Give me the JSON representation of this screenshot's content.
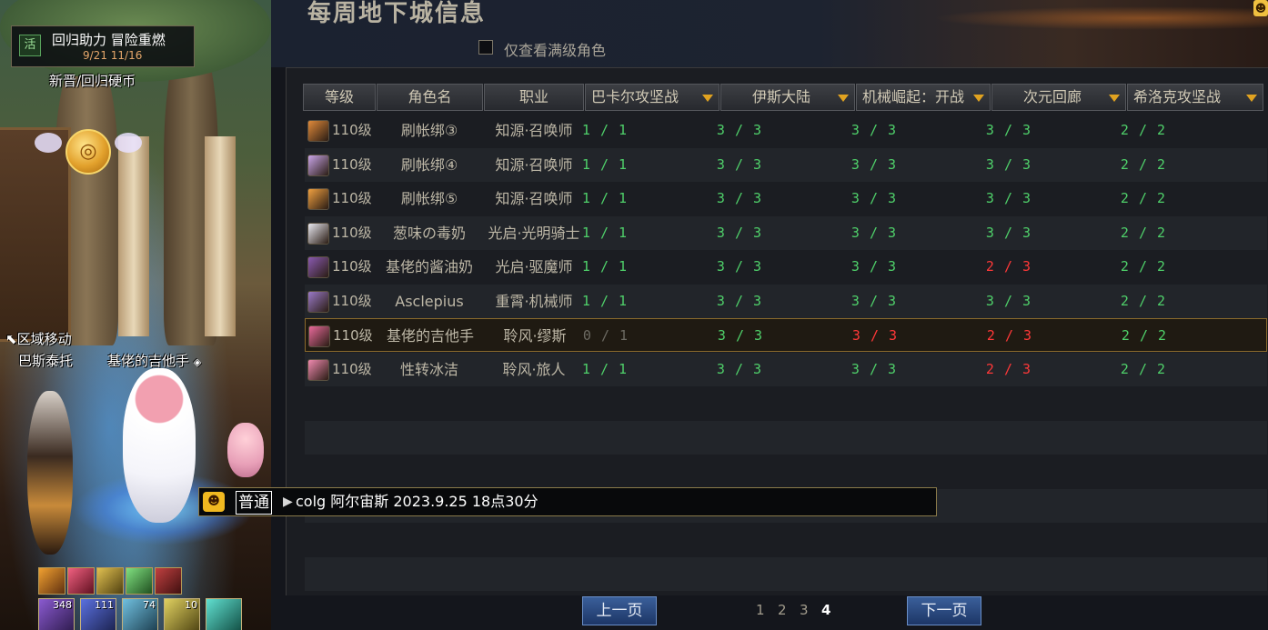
{
  "scene": {
    "event": {
      "badge": "活",
      "title": "回归助力 冒险重燃",
      "date": "9/21 11/16"
    },
    "coin_label": "新晋/回归硬币",
    "coin_icon": "gold-coin-icon",
    "zone_move": "区域移动",
    "zone_name": "巴斯泰托",
    "player_name": "基佬的吉他手",
    "slots": [
      {
        "count": "348"
      },
      {
        "count": "111"
      },
      {
        "count": "74"
      },
      {
        "count": "10"
      },
      {
        "count": ""
      }
    ]
  },
  "panel": {
    "title": "每周地下城信息",
    "filter_label": "仅查看满级角色",
    "filter_checked": false
  },
  "table": {
    "columns": [
      "等级",
      "角色名",
      "职业",
      "巴卡尔攻坚战",
      "伊斯大陆",
      "机械崛起：开战",
      "次元回廊",
      "希洛克攻坚战"
    ],
    "rows": [
      {
        "level": "110级",
        "name": "刷帐绑③",
        "job": "知源·召唤师",
        "p": [
          "1 / 1",
          "3 / 3",
          "3 / 3",
          "3 / 3",
          "2 / 2"
        ],
        "s": [
          "ok",
          "ok",
          "ok",
          "ok",
          "ok"
        ],
        "avatar": "#e08a3a"
      },
      {
        "level": "110级",
        "name": "刷帐绑④",
        "job": "知源·召唤师",
        "p": [
          "1 / 1",
          "3 / 3",
          "3 / 3",
          "3 / 3",
          "2 / 2"
        ],
        "s": [
          "ok",
          "ok",
          "ok",
          "ok",
          "ok"
        ],
        "avatar": "#c9a5e8"
      },
      {
        "level": "110级",
        "name": "刷帐绑⑤",
        "job": "知源·召唤师",
        "p": [
          "1 / 1",
          "3 / 3",
          "3 / 3",
          "3 / 3",
          "2 / 2"
        ],
        "s": [
          "ok",
          "ok",
          "ok",
          "ok",
          "ok"
        ],
        "avatar": "#f0a040"
      },
      {
        "level": "110级",
        "name": "葱味の毒奶",
        "job": "光启·光明骑士",
        "p": [
          "1 / 1",
          "3 / 3",
          "3 / 3",
          "3 / 3",
          "2 / 2"
        ],
        "s": [
          "ok",
          "ok",
          "ok",
          "ok",
          "ok"
        ],
        "avatar": "#e8e8f0"
      },
      {
        "level": "110级",
        "name": "基佬的酱油奶",
        "job": "光启·驱魔师",
        "p": [
          "1 / 1",
          "3 / 3",
          "3 / 3",
          "2 / 3",
          "2 / 2"
        ],
        "s": [
          "ok",
          "ok",
          "ok",
          "bad",
          "ok"
        ],
        "avatar": "#8a5ab0"
      },
      {
        "level": "110级",
        "name": "Asclepius",
        "job": "重霄·机械师",
        "p": [
          "1 / 1",
          "3 / 3",
          "3 / 3",
          "3 / 3",
          "2 / 2"
        ],
        "s": [
          "ok",
          "ok",
          "ok",
          "ok",
          "ok"
        ],
        "avatar": "#9a7ac8"
      },
      {
        "level": "110级",
        "name": "基佬的吉他手",
        "job": "聆风·缪斯",
        "p": [
          "0 / 1",
          "3 / 3",
          "3 / 3",
          "2 / 3",
          "2 / 2"
        ],
        "s": [
          "dim",
          "ok",
          "bad",
          "bad",
          "ok"
        ],
        "avatar": "#e86a9a"
      },
      {
        "level": "110级",
        "name": "性转冰洁",
        "job": "聆风·旅人",
        "p": [
          "1 / 1",
          "3 / 3",
          "3 / 3",
          "2 / 3",
          "2 / 2"
        ],
        "s": [
          "ok",
          "ok",
          "ok",
          "bad",
          "ok"
        ],
        "avatar": "#f08ab0"
      }
    ],
    "selected_index": 6
  },
  "chat": {
    "icon": "chat-face-icon",
    "channel": "普通",
    "text": "colg 阿尔宙斯 2023.9.25 18点30分"
  },
  "pager": {
    "prev_label": "上一页",
    "next_label": "下一页",
    "pages": [
      "1",
      "2",
      "3",
      "4"
    ],
    "current_page": "4"
  },
  "colors": {
    "ok": "#4fd06a",
    "bad": "#ff3838",
    "accent": "#e0a220",
    "button": "#2a4a80"
  }
}
